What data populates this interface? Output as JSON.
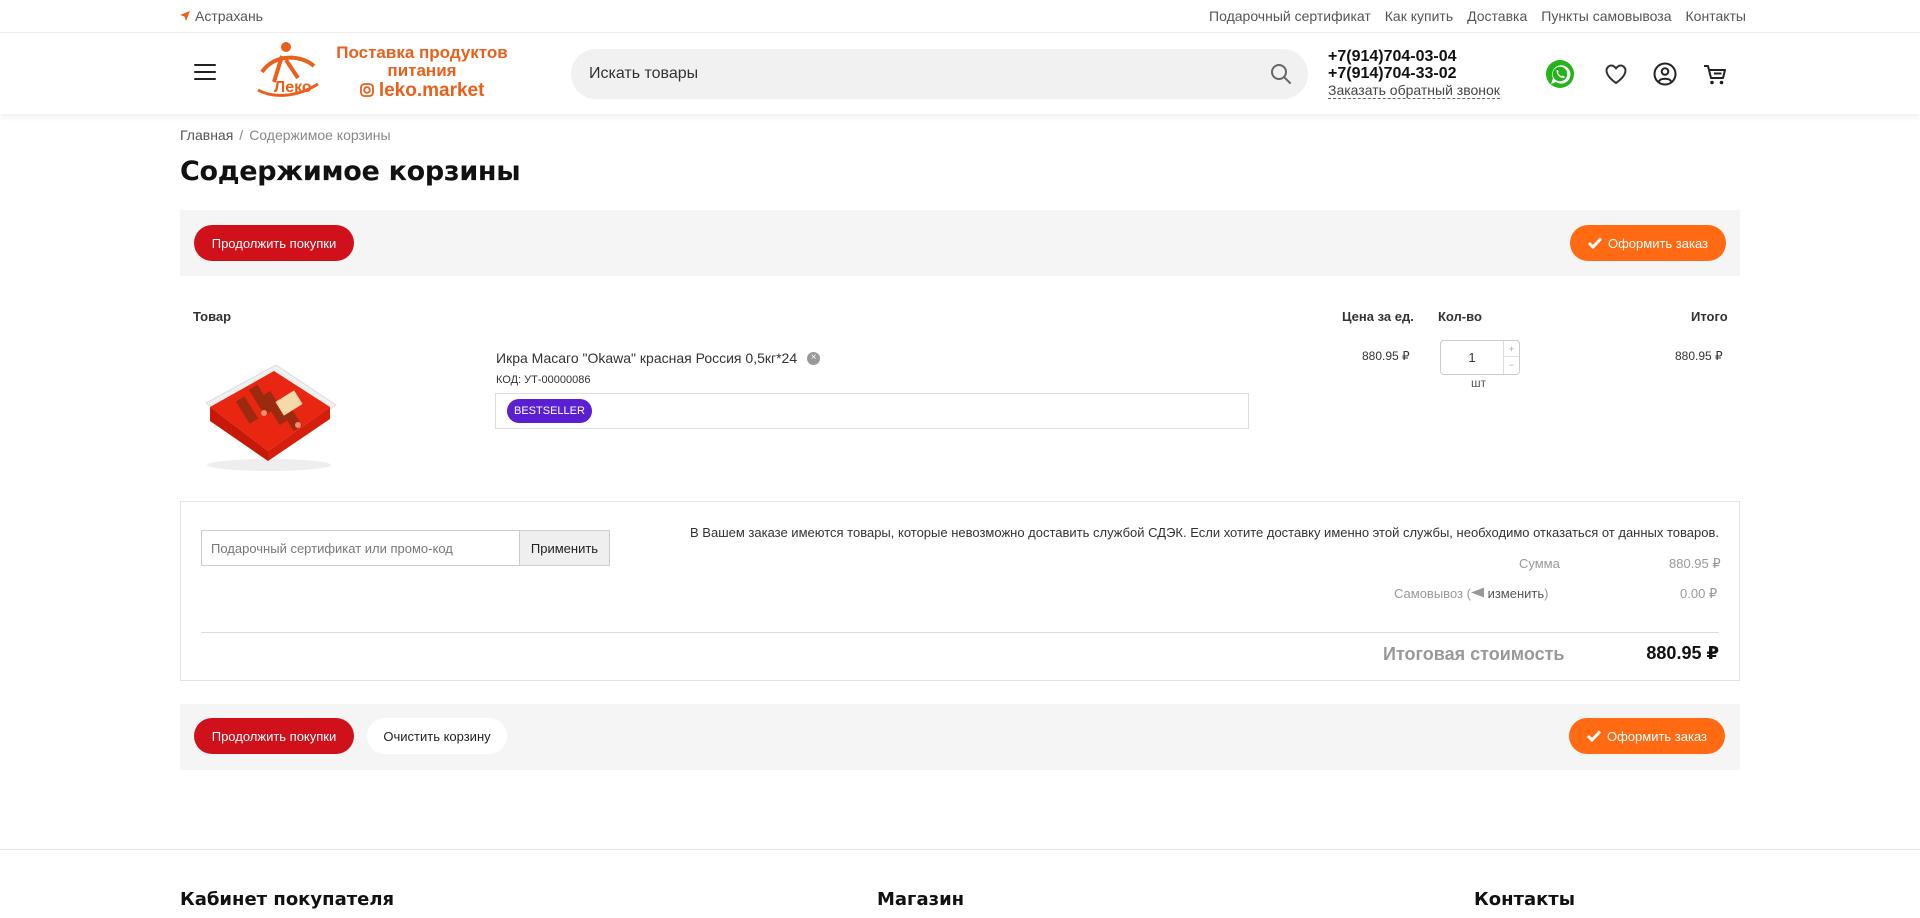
{
  "topbar": {
    "city": "Астрахань",
    "links": [
      "Подарочный сертификат",
      "Как купить",
      "Доставка",
      "Пункты самовывоза",
      "Контакты"
    ]
  },
  "header": {
    "logo": {
      "line1": "Поставка продуктов",
      "line2": "питания",
      "line3": "leko.market",
      "mark": "Леко"
    },
    "search_placeholder": "Искать товары",
    "phone1": "+7(914)704-03-04",
    "phone2": "+7(914)704-33-02",
    "callback": "Заказать обратный звонок",
    "icons": [
      "whatsapp-icon",
      "heart-icon",
      "user-icon",
      "cart-icon"
    ]
  },
  "breadcrumb": {
    "home": "Главная",
    "separator": "/",
    "current": "Содержимое корзины"
  },
  "title": "Содержимое корзины",
  "actions": {
    "continue": "Продолжить покупки",
    "checkout": "Оформить заказ",
    "clear": "Очистить корзину"
  },
  "table": {
    "headers": {
      "product": "Товар",
      "price": "Цена за ед.",
      "qty": "Кол-во",
      "total": "Итого"
    },
    "items": [
      {
        "name": "Икра Масаго \"Okawa\" красная Россия 0,5кг*24",
        "code": "КОД: УТ-00000086",
        "badge": "BESTSELLER",
        "price": "880.95 ₽",
        "qty": "1",
        "unit": "шт",
        "total": "880.95 ₽"
      }
    ]
  },
  "totals": {
    "promo_placeholder": "Подарочный сертификат или промо-код",
    "apply": "Применить",
    "warning": "В Вашем заказе имеются товары, которые невозможно доставить службой СДЭК. Если хотите доставку именно этой службы, необходимо отказаться от данных товаров.",
    "sum_label": "Сумма",
    "sum_value": "880.95 ₽",
    "pickup_label": "Самовывоз (",
    "pickup_change": "изменить",
    "pickup_close": ")",
    "pickup_value": "0.00 ₽",
    "grand_label": "Итоговая стоимость",
    "grand_value": "880.95 ₽"
  },
  "footer": {
    "col1": "Кабинет покупателя",
    "col2": "Магазин",
    "col3": "Контакты"
  },
  "colors": {
    "red": "#d0101b",
    "orange": "#ff6a13",
    "badge": "#5a1fd0",
    "whatsapp": "#25b31c"
  }
}
